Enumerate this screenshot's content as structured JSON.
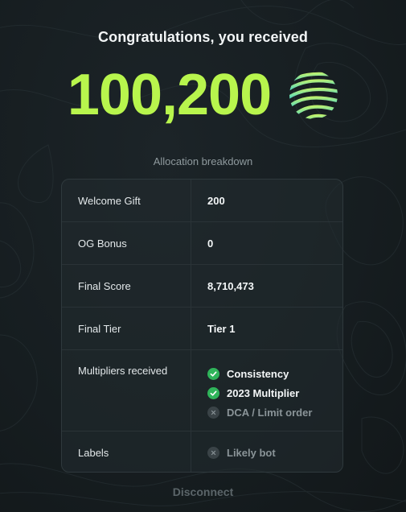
{
  "header": {
    "title": "Congratulations, you received",
    "amount": "100,200",
    "token_icon": "striped-sphere-token-icon"
  },
  "breakdown": {
    "section_label": "Allocation breakdown",
    "rows": [
      {
        "label": "Welcome Gift",
        "value": "200"
      },
      {
        "label": "OG Bonus",
        "value": "0"
      },
      {
        "label": "Final Score",
        "value": "8,710,473"
      },
      {
        "label": "Final Tier",
        "value": "Tier 1"
      }
    ],
    "multipliers": {
      "label": "Multipliers received",
      "items": [
        {
          "text": "Consistency",
          "status": "received",
          "icon": "check-circle-icon"
        },
        {
          "text": "2023 Multiplier",
          "status": "received",
          "icon": "check-circle-icon"
        },
        {
          "text": "DCA / Limit order",
          "status": "not-received",
          "icon": "x-circle-icon"
        }
      ]
    },
    "labels": {
      "label": "Labels",
      "items": [
        {
          "text": "Likely bot",
          "status": "not-applied",
          "icon": "x-circle-icon"
        }
      ]
    }
  },
  "footer": {
    "disconnect_label": "Disconnect"
  },
  "colors": {
    "background": "#161d20",
    "amount_green": "#b8f54d",
    "check_green": "#2fb45a",
    "muted_text": "#8f9a9e",
    "card_border": "#2f393d"
  }
}
